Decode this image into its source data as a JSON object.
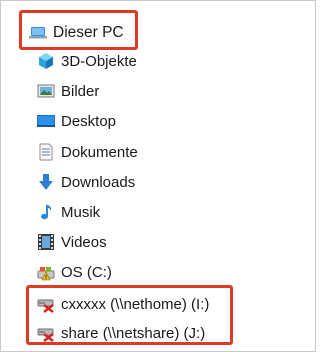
{
  "tree": {
    "root": {
      "label": "Dieser PC",
      "icon": "pc-icon"
    },
    "items": [
      {
        "label": "3D-Objekte",
        "icon": "3d-objects-icon"
      },
      {
        "label": "Bilder",
        "icon": "pictures-icon"
      },
      {
        "label": "Desktop",
        "icon": "desktop-icon"
      },
      {
        "label": "Dokumente",
        "icon": "documents-icon"
      },
      {
        "label": "Downloads",
        "icon": "downloads-icon"
      },
      {
        "label": "Musik",
        "icon": "music-icon"
      },
      {
        "label": "Videos",
        "icon": "videos-icon"
      },
      {
        "label": "OS (C:)",
        "icon": "drive-warning-icon"
      },
      {
        "label": "cxxxxx (\\\\nethome) (I:)",
        "icon": "disconnected-network-drive-icon"
      },
      {
        "label": "share (\\\\netshare) (J:)",
        "icon": "disconnected-network-drive-icon"
      }
    ]
  },
  "colors": {
    "highlight": "#e03a24"
  }
}
